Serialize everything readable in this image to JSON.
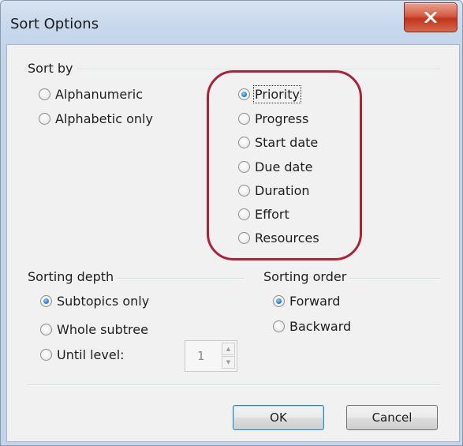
{
  "window": {
    "title": "Sort Options"
  },
  "sort_by": {
    "label": "Sort by",
    "left_options": [
      {
        "label": "Alphanumeric",
        "checked": false
      },
      {
        "label": "Alphabetic only",
        "checked": false
      }
    ],
    "right_options": [
      {
        "label": "Priority",
        "checked": true
      },
      {
        "label": "Progress",
        "checked": false
      },
      {
        "label": "Start date",
        "checked": false
      },
      {
        "label": "Due date",
        "checked": false
      },
      {
        "label": "Duration",
        "checked": false
      },
      {
        "label": "Effort",
        "checked": false
      },
      {
        "label": "Resources",
        "checked": false
      }
    ]
  },
  "sorting_depth": {
    "label": "Sorting depth",
    "options": [
      {
        "label": "Subtopics only",
        "checked": true
      },
      {
        "label": "Whole subtree",
        "checked": false
      },
      {
        "label": "Until level:",
        "checked": false
      }
    ],
    "level_value": "1"
  },
  "sorting_order": {
    "label": "Sorting order",
    "options": [
      {
        "label": "Forward",
        "checked": true
      },
      {
        "label": "Backward",
        "checked": false
      }
    ]
  },
  "buttons": {
    "ok": "OK",
    "cancel": "Cancel"
  },
  "colors": {
    "highlight": "#a8243a",
    "close": "#c0341c"
  }
}
